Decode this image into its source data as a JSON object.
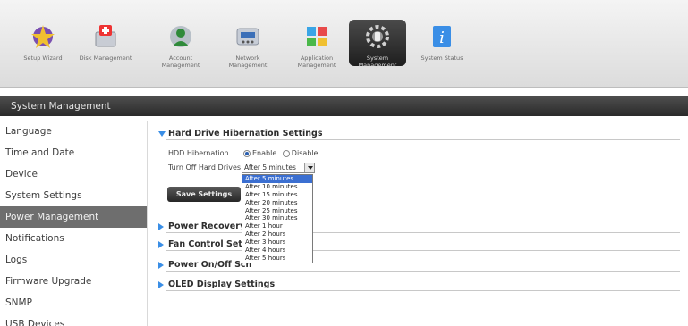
{
  "toolbar": {
    "items": [
      {
        "label": "Setup Wizard",
        "icon": "wizard-icon"
      },
      {
        "label": "Disk Management",
        "icon": "disk-icon"
      },
      {
        "label": "Account Management",
        "icon": "account-icon"
      },
      {
        "label": "Network Management",
        "icon": "network-icon"
      },
      {
        "label": "Application Management",
        "icon": "application-icon"
      },
      {
        "label": "System Management",
        "icon": "system-icon",
        "active": true
      },
      {
        "label": "System Status",
        "icon": "status-icon"
      }
    ]
  },
  "section": {
    "title": "System Management"
  },
  "sidebar": {
    "items": [
      {
        "label": "Language"
      },
      {
        "label": "Time and Date"
      },
      {
        "label": "Device"
      },
      {
        "label": "System Settings"
      },
      {
        "label": "Power Management",
        "active": true
      },
      {
        "label": "Notifications"
      },
      {
        "label": "Logs"
      },
      {
        "label": "Firmware Upgrade"
      },
      {
        "label": "SNMP"
      },
      {
        "label": "USB Devices"
      }
    ]
  },
  "hibernation": {
    "title": "Hard Drive Hibernation Settings",
    "hdd_label": "HDD Hibernation",
    "enable_label": "Enable",
    "disable_label": "Disable",
    "selected": "Enable",
    "turnoff_label": "Turn Off Hard Drives",
    "turnoff_value": "After 5 minutes",
    "options": [
      "After 5 minutes",
      "After 10 minutes",
      "After 15 minutes",
      "After 20 minutes",
      "After 25 minutes",
      "After 30 minutes",
      "After 1 hour",
      "After 2 hours",
      "After 3 hours",
      "After 4 hours",
      "After 5 hours"
    ],
    "save_label": "Save Settings"
  },
  "sections": {
    "power_recovery": "Power Recovery S",
    "fan_control": "Fan Control Setti",
    "power_onoff": "Power On/Off Sch",
    "oled": "OLED Display Settings"
  },
  "colors": {
    "accent": "#3a8ee6",
    "highlight": "#3b6fd1",
    "header_bg": "#2a2a2a"
  }
}
